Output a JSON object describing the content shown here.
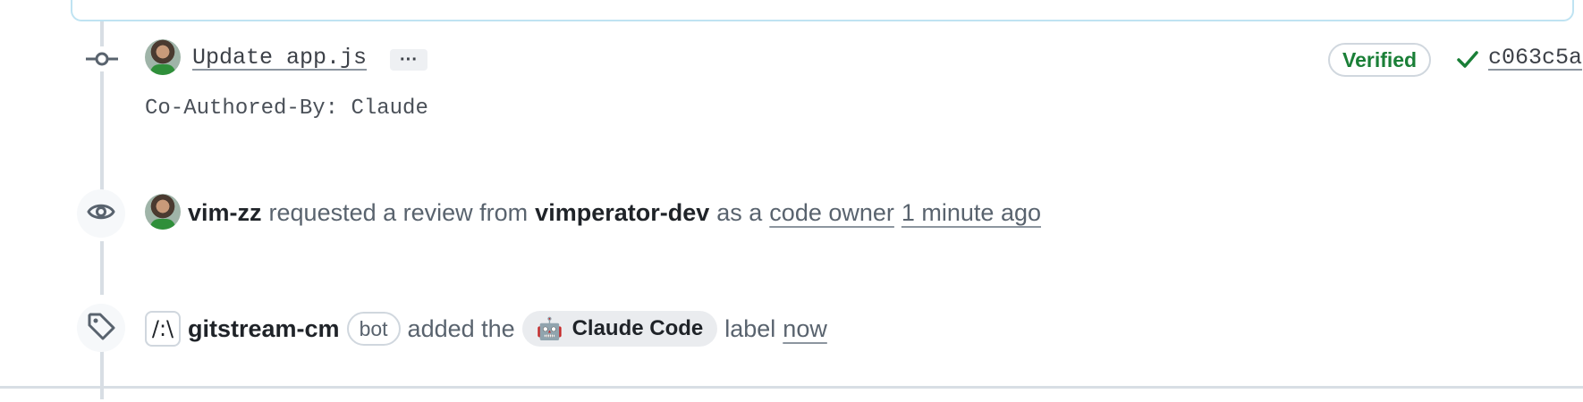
{
  "commit": {
    "title": "Update app.js",
    "ellipsis": "···",
    "body": "Co-Authored-By: Claude",
    "verified_label": "Verified",
    "sha": "c063c5a"
  },
  "review_event": {
    "actor": "vim-zz",
    "text_requested": "requested a review from",
    "reviewer": "vimperator-dev",
    "text_as_a": "as a",
    "code_owner_link": "code owner",
    "time": "1 minute ago"
  },
  "label_event": {
    "bot_avatar_glyph": "/:\\",
    "actor": "gitstream-cm",
    "bot_badge": "bot",
    "text_added": "added the",
    "label_emoji": "🤖",
    "label_name": "Claude Code",
    "text_label": "label",
    "time": "now"
  },
  "colors": {
    "verified": "#1a7f37",
    "timeline": "#d8dee4",
    "chip_bg": "#eaecef"
  }
}
